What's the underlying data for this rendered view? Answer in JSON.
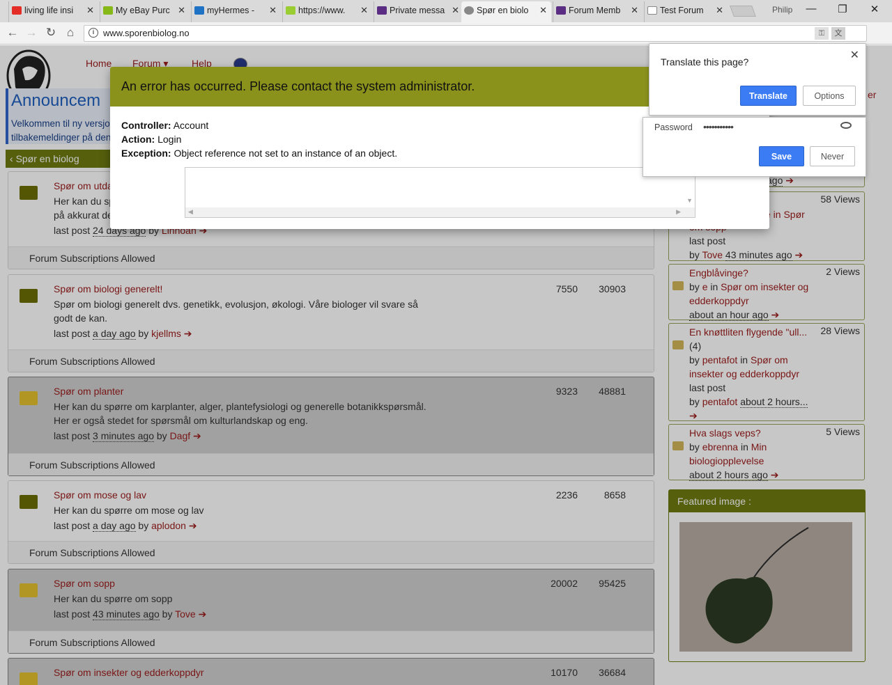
{
  "browser": {
    "tabs": [
      {
        "title": "living life insi",
        "fav": "#e52d27"
      },
      {
        "title": "My eBay Purc",
        "fav": "#86b817"
      },
      {
        "title": "myHermes -",
        "fav": "#1f72c4"
      },
      {
        "title": "https://www.",
        "fav": "#9acd32"
      },
      {
        "title": "Private messa",
        "fav": "#5a2d82"
      },
      {
        "title": "Spør en biolo",
        "fav": "#888888"
      },
      {
        "title": "Forum Memb",
        "fav": "#5a2d82"
      },
      {
        "title": "Test Forum",
        "fav": "#aaaaaa"
      }
    ],
    "profile": "Philip",
    "url": "www.sporenbiolog.no"
  },
  "nav": {
    "home": "Home",
    "forum": "Forum",
    "help": "Help"
  },
  "announcement": {
    "heading": "Announcem",
    "text": "Velkommen til ny versjo tilbakemeldinger på den"
  },
  "breadcrumb": "Spør en biolog",
  "forums": [
    {
      "name": "Spør om utda",
      "desc": "Her kan du sp på akkurat de",
      "last_ago": "24 days ago",
      "user": "Linnoan",
      "topics": "",
      "posts": "",
      "subs": "Forum Subscriptions Allowed"
    },
    {
      "name": "Spør om biologi generelt!",
      "desc": "Spør om biologi generelt dvs. genetikk, evolusjon, økologi. Våre biologer vil svare så godt de kan.",
      "last_ago": "a day ago",
      "user": "kjellms",
      "topics": "7550",
      "posts": "30903",
      "subs": "Forum Subscriptions Allowed"
    },
    {
      "name": "Spør om planter",
      "desc": "Her kan du spørre om karplanter, alger, plantefysiologi og generelle botanikkspørsmål. Her er også stedet for spørsmål om kulturlandskap og eng.",
      "last_ago": "3 minutes ago",
      "user": "Dagf",
      "topics": "9323",
      "posts": "48881",
      "subs": "Forum Subscriptions Allowed"
    },
    {
      "name": "Spør om mose og lav",
      "desc": "Her kan du spørre om mose og lav",
      "last_ago": "a day ago",
      "user": "aplodon",
      "topics": "2236",
      "posts": "8658",
      "subs": "Forum Subscriptions Allowed"
    },
    {
      "name": "Spør om sopp",
      "desc": "Her kan du spørre om sopp",
      "last_ago": "43 minutes ago",
      "user": "Tove",
      "topics": "20002",
      "posts": "95425",
      "subs": "Forum Subscriptions Allowed"
    },
    {
      "name": "Spør om insekter og edderkoppdyr",
      "topics": "10170",
      "posts": "36684"
    }
  ],
  "labels": {
    "last_post": "last post",
    "by": "by",
    "in": "in"
  },
  "sidebar": {
    "topics": [
      {
        "ago_tail": "ago"
      },
      {
        "title_tail": "e in Spør",
        "line2": "om sopp",
        "last_post": "last post",
        "by": "by",
        "user": "Tove",
        "ago": "43 minutes ago",
        "views": "58 Views"
      },
      {
        "title": "Engblåvinge?",
        "by": "by",
        "user": "e",
        "in": "in",
        "forum": "Spør om insekter og edderkoppdyr",
        "ago": "about an hour ago",
        "views": "2 Views"
      },
      {
        "title": "En knøttliten flygende \"ull...",
        "count": "(4)",
        "by": "by",
        "user": "pentafot",
        "in": "in",
        "forum": "Spør om insekter og edderkoppdyr",
        "last_post": "last post",
        "ago": "about 2 hours...",
        "views": "28 Views"
      },
      {
        "title": "Hva slags veps?",
        "by": "by",
        "user": "ebrenna",
        "in": "in",
        "forum": "Min biologiopplevelse",
        "ago": "about 2 hours ago",
        "views": "5 Views"
      }
    ],
    "featured_heading": "Featured image :",
    "side_link": "er"
  },
  "error_modal": {
    "heading": "An error has occurred. Please contact the system administrator.",
    "controller_label": "Controller:",
    "controller": "Account",
    "action_label": "Action:",
    "action": "Login",
    "exception_label": "Exception:",
    "exception": "Object reference not set to an instance of an object."
  },
  "translate_bubble": {
    "question": "Translate this page?",
    "translate": "Translate",
    "options": "Options"
  },
  "password_bubble": {
    "label": "Password",
    "masked": "•••••••••••",
    "save": "Save",
    "never": "Never"
  },
  "colors": {
    "olive": "#6e7a10",
    "link_red": "#9b1b1b",
    "chrome_blue": "#3b7cf4"
  }
}
